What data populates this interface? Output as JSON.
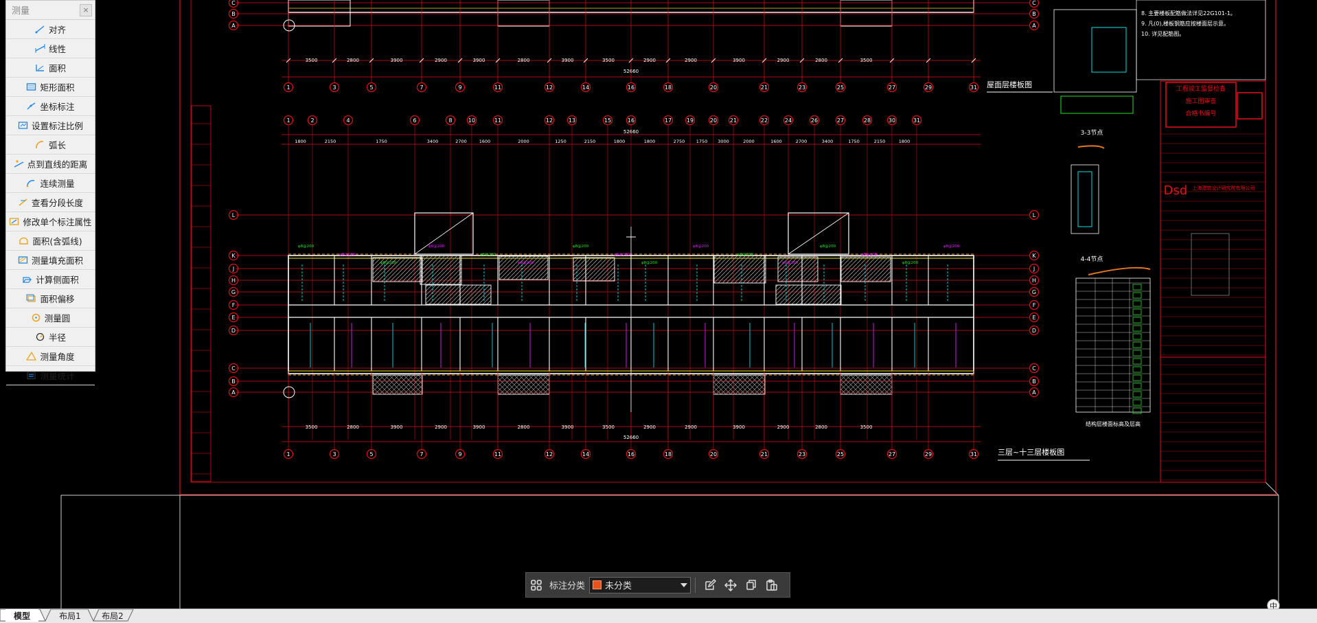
{
  "measure_panel": {
    "title": "测量",
    "close_icon": "close-icon",
    "tools": [
      {
        "label": "对齐",
        "icon": "align-measure-icon"
      },
      {
        "label": "线性",
        "icon": "linear-measure-icon"
      },
      {
        "label": "面积",
        "icon": "area-icon"
      },
      {
        "label": "矩形面积",
        "icon": "rect-area-icon"
      },
      {
        "label": "坐标标注",
        "icon": "coordinate-icon"
      },
      {
        "label": "设置标注比例",
        "icon": "scale-setting-icon"
      },
      {
        "label": "弧长",
        "icon": "arc-length-icon"
      },
      {
        "label": "点到直线的距离",
        "icon": "point-line-distance-icon"
      },
      {
        "label": "连续测量",
        "icon": "continuous-measure-icon"
      },
      {
        "label": "查看分段长度",
        "icon": "segment-length-icon"
      },
      {
        "label": "修改单个标注属性",
        "icon": "edit-annotation-icon"
      },
      {
        "label": "面积(含弧线)",
        "icon": "arc-area-icon"
      },
      {
        "label": "测量填充面积",
        "icon": "fill-area-icon"
      },
      {
        "label": "计算侧面积",
        "icon": "side-area-icon"
      },
      {
        "label": "面积偏移",
        "icon": "area-offset-icon"
      },
      {
        "label": "测量圆",
        "icon": "circle-measure-icon"
      },
      {
        "label": "半径",
        "icon": "radius-icon"
      },
      {
        "label": "测量角度",
        "icon": "angle-icon"
      },
      {
        "label": "测量统计",
        "icon": "statistics-icon"
      }
    ]
  },
  "annotation_toolbar": {
    "category_label": "标注分类",
    "category_value": "未分类",
    "category_color": "#e8521e",
    "buttons": [
      "grid-apps-icon",
      "edit-icon",
      "move-icon",
      "copy-icon",
      "paste-icon"
    ]
  },
  "layout_tabs": [
    "模型",
    "布局1",
    "布局2"
  ],
  "active_tab": "模型",
  "ime_indicator": "中",
  "drawing": {
    "upper_title": "屋面层楼板图",
    "lower_title": "三层~十三层楼板图",
    "upper_section_title": "3-3节点",
    "lower_section_title": "4-4节点",
    "table_caption": "结构层楼面标高及层高",
    "total_dimension": "52660",
    "grid_numbers": [
      "1",
      "3",
      "5",
      "7",
      "9",
      "11",
      "12",
      "14",
      "16",
      "18",
      "20",
      "21",
      "23",
      "25",
      "27",
      "29",
      "31"
    ],
    "top_grid_numbers": [
      "1",
      "2",
      "4",
      "6",
      "8",
      "10",
      "11",
      "12",
      "13",
      "15",
      "16",
      "17",
      "19",
      "20",
      "21",
      "22",
      "24",
      "26",
      "27",
      "28",
      "30",
      "31"
    ],
    "row_letters_lower": [
      "L",
      "K",
      "J",
      "H",
      "G",
      "F",
      "E",
      "D",
      "C",
      "B",
      "A"
    ],
    "row_letters_top": [
      "C",
      "B",
      "A"
    ],
    "bay_dims": [
      "3500",
      "2800",
      "3900",
      "2900",
      "3900",
      "2800",
      "3900",
      "3500",
      "2900",
      "2900",
      "3900",
      "2900",
      "2800",
      "3500"
    ],
    "top_bay_dims": [
      "1800",
      "2150",
      "1750",
      "3400",
      "2700",
      "1600",
      "2000",
      "1250",
      "2150",
      "1800",
      "1800",
      "2750",
      "1750",
      "3000",
      "2000",
      "1600",
      "2700",
      "3400",
      "1750",
      "2150",
      "1800"
    ],
    "stamp_lines": [
      "工程竣工监督检查",
      "施工图审查",
      "合格书编号"
    ],
    "company": "上海建筑设计研究院有限公司",
    "company_short": "Dsd",
    "notes": [
      "8. 主要楼板配筋做法详见22G101-1。",
      "9. 凡(0),楼板钢筋应按楼面层示意。",
      "10. 详见配筋图。"
    ],
    "colors": {
      "grid_red": "#e3101a",
      "wall_white": "#ffffff",
      "cyan": "#00e1e6",
      "yellow": "#f2e21a",
      "magenta": "#e21dff",
      "green": "#28e028",
      "hatch_gray": "#9a9a9a"
    }
  }
}
